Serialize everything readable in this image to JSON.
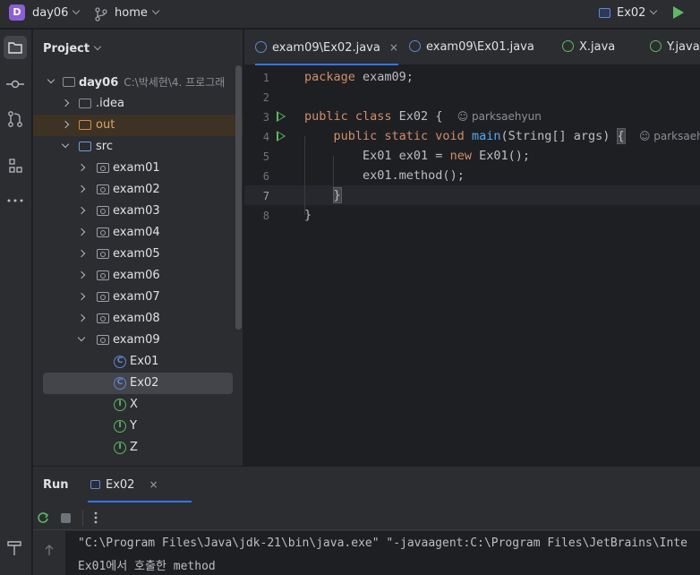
{
  "titlebar": {
    "project_badge": "D",
    "project_name": "day06",
    "branch": "home",
    "run_config": "Ex02"
  },
  "project_panel": {
    "title": "Project",
    "root_label": "day06",
    "root_path": "C:\\박세현\\4. 프로그래",
    "items": [
      {
        "label": ".idea"
      },
      {
        "label": "out"
      },
      {
        "label": "src"
      },
      {
        "label": "exam01"
      },
      {
        "label": "exam02"
      },
      {
        "label": "exam03"
      },
      {
        "label": "exam04"
      },
      {
        "label": "exam05"
      },
      {
        "label": "exam06"
      },
      {
        "label": "exam07"
      },
      {
        "label": "exam08"
      },
      {
        "label": "exam09"
      },
      {
        "label": "Ex01"
      },
      {
        "label": "Ex02"
      },
      {
        "label": "X"
      },
      {
        "label": "Y"
      },
      {
        "label": "Z"
      }
    ]
  },
  "tabs": [
    {
      "label": "exam09\\Ex02.java",
      "close": "×"
    },
    {
      "label": "exam09\\Ex01.java"
    },
    {
      "label": "X.java"
    },
    {
      "label": "Y.java"
    }
  ],
  "editor": {
    "line_numbers": [
      "1",
      "2",
      "3",
      "4",
      "5",
      "6",
      "7",
      "8"
    ],
    "l1_kw": "package",
    "l1_rest": " exam09;",
    "l3_kw": "public class",
    "l3_rest": " Ex02 {",
    "l3_author": "parksaehyun",
    "l4_kw": "public static void",
    "l4_fn": "main",
    "l4_rest": "(String[] args) ",
    "l4_brace": "{",
    "l4_author": "parksaehyu",
    "l5_a": "Ex01 ex01 = ",
    "l5_kw": "new",
    "l5_b": " Ex01();",
    "l6": "ex01.method();",
    "l7": "}",
    "l8": "}"
  },
  "run_panel": {
    "title": "Run",
    "tab_label": "Ex02",
    "tab_close": "×",
    "console_lines": [
      "\"C:\\Program Files\\Java\\jdk-21\\bin\\java.exe\" \"-javaagent:C:\\Program Files\\JetBrains\\Inte",
      "Ex01에서 호출한 method"
    ]
  }
}
